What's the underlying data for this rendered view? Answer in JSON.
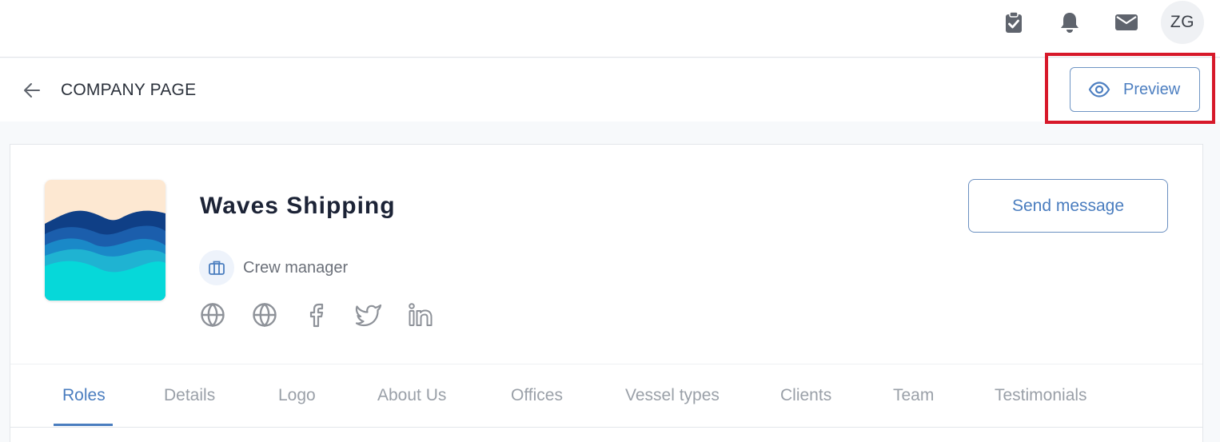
{
  "topbar": {
    "icons": [
      {
        "name": "clipboard-check-icon"
      },
      {
        "name": "bell-icon"
      },
      {
        "name": "mail-icon"
      }
    ],
    "avatar_initials": "ZG"
  },
  "page_header": {
    "back_icon": "arrow-left-icon",
    "title": "COMPANY PAGE",
    "preview_label": "Preview",
    "preview_icon": "eye-icon",
    "highlight_color": "#d7192a"
  },
  "company": {
    "name": "Waves Shipping",
    "role": "Crew manager",
    "role_icon": "briefcase-icon",
    "send_message_label": "Send message",
    "social_links": [
      {
        "icon": "globe-icon"
      },
      {
        "icon": "globe-icon"
      },
      {
        "icon": "facebook-icon"
      },
      {
        "icon": "twitter-icon"
      },
      {
        "icon": "linkedin-icon"
      }
    ]
  },
  "tabs": [
    {
      "label": "Roles",
      "active": true
    },
    {
      "label": "Details",
      "active": false
    },
    {
      "label": "Logo",
      "active": false
    },
    {
      "label": "About Us",
      "active": false
    },
    {
      "label": "Offices",
      "active": false
    },
    {
      "label": "Vessel types",
      "active": false
    },
    {
      "label": "Clients",
      "active": false
    },
    {
      "label": "Team",
      "active": false
    },
    {
      "label": "Testimonials",
      "active": false
    }
  ],
  "colors": {
    "accent": "#4a7dbf",
    "icon_gray": "#6b7079",
    "tab_inactive": "#9aa0a8"
  }
}
